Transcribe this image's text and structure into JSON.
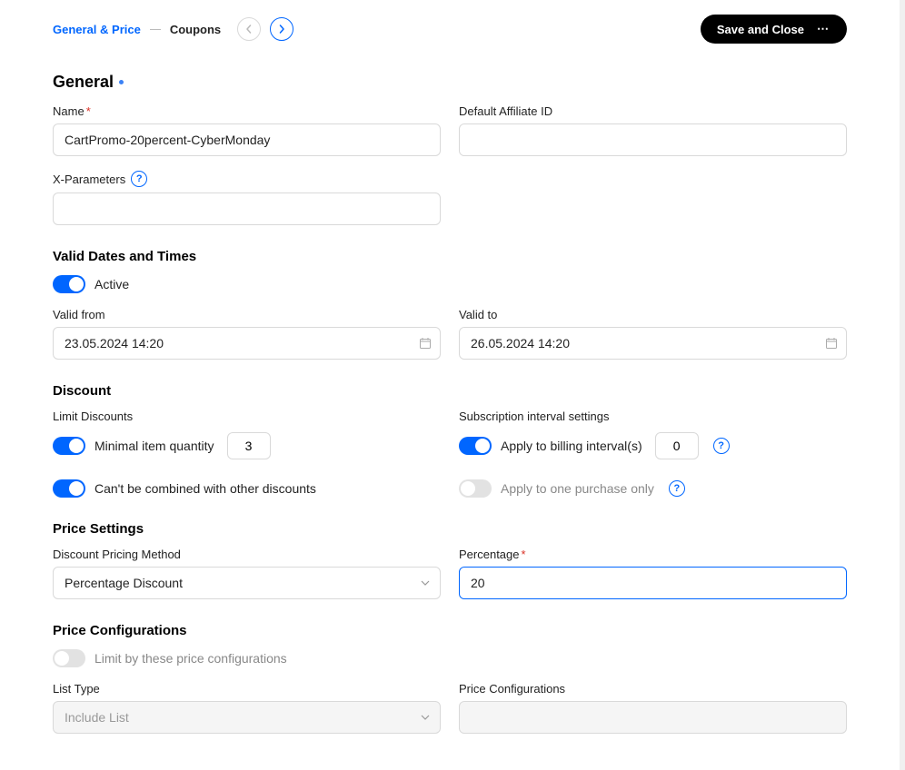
{
  "breadcrumb": {
    "tab1": "General & Price",
    "tab2": "Coupons"
  },
  "header": {
    "save_label": "Save and Close"
  },
  "general": {
    "title": "General",
    "name_label": "Name",
    "name_value": "CartPromo-20percent-CyberMonday",
    "affiliate_label": "Default Affiliate ID",
    "affiliate_value": "",
    "xparams_label": "X-Parameters",
    "xparams_value": ""
  },
  "valid": {
    "title": "Valid Dates and Times",
    "active_label": "Active",
    "from_label": "Valid from",
    "from_value": "23.05.2024 14:20",
    "to_label": "Valid to",
    "to_value": "26.05.2024 14:20"
  },
  "discount": {
    "title": "Discount",
    "limit_label": "Limit Discounts",
    "min_qty_label": "Minimal item quantity",
    "min_qty_value": "3",
    "no_combine_label": "Can't be combined with other discounts",
    "sub_label": "Subscription interval settings",
    "apply_billing_label": "Apply to billing interval(s)",
    "apply_billing_value": "0",
    "apply_one_label": "Apply to one purchase only"
  },
  "price_settings": {
    "title": "Price Settings",
    "method_label": "Discount Pricing Method",
    "method_value": "Percentage Discount",
    "pct_label": "Percentage",
    "pct_value": "20"
  },
  "price_config": {
    "title": "Price Configurations",
    "limit_label": "Limit by these price configurations",
    "list_type_label": "List Type",
    "list_type_value": "Include List",
    "config_label": "Price Configurations",
    "config_value": ""
  }
}
